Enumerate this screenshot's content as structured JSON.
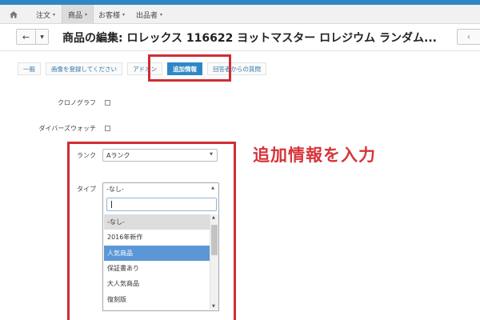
{
  "colors": {
    "accent": "#2f86c5",
    "annotation": "#d02d35",
    "selected": "#5b97d6"
  },
  "nav": {
    "home_icon": "home-icon",
    "menus": [
      {
        "label": "注文"
      },
      {
        "label": "商品"
      },
      {
        "label": "お客様"
      },
      {
        "label": "出品者"
      }
    ],
    "caret": "▾"
  },
  "header": {
    "back_glyph": "←",
    "drop_glyph": "▼",
    "title": "商品の編集: ロレックス 116622 ヨットマスター ロレジウム ランダム...",
    "right_glyph": "‹"
  },
  "tabs": [
    {
      "label": "一般"
    },
    {
      "label": "画像を登録してください"
    },
    {
      "label": "アドオン"
    },
    {
      "label": "追加情報"
    },
    {
      "label": "回答者からの質問"
    }
  ],
  "form": {
    "chrono": {
      "label": "クロノグラフ"
    },
    "diver": {
      "label": "ダイバーズウォッチ"
    },
    "rank": {
      "label": "ランク",
      "value": "Aランク",
      "arrow": "▼"
    },
    "type": {
      "label": "タイプ",
      "value": "-なし-",
      "arrow": "▲",
      "search_placeholder": "",
      "options": [
        "-なし-",
        "2016年新作",
        "人気商品",
        "保証書あり",
        "大人気商品",
        "復刻版"
      ]
    }
  },
  "scroll": {
    "up": "▲",
    "down": "▼"
  },
  "annotation": {
    "text": "追加情報を入力"
  }
}
